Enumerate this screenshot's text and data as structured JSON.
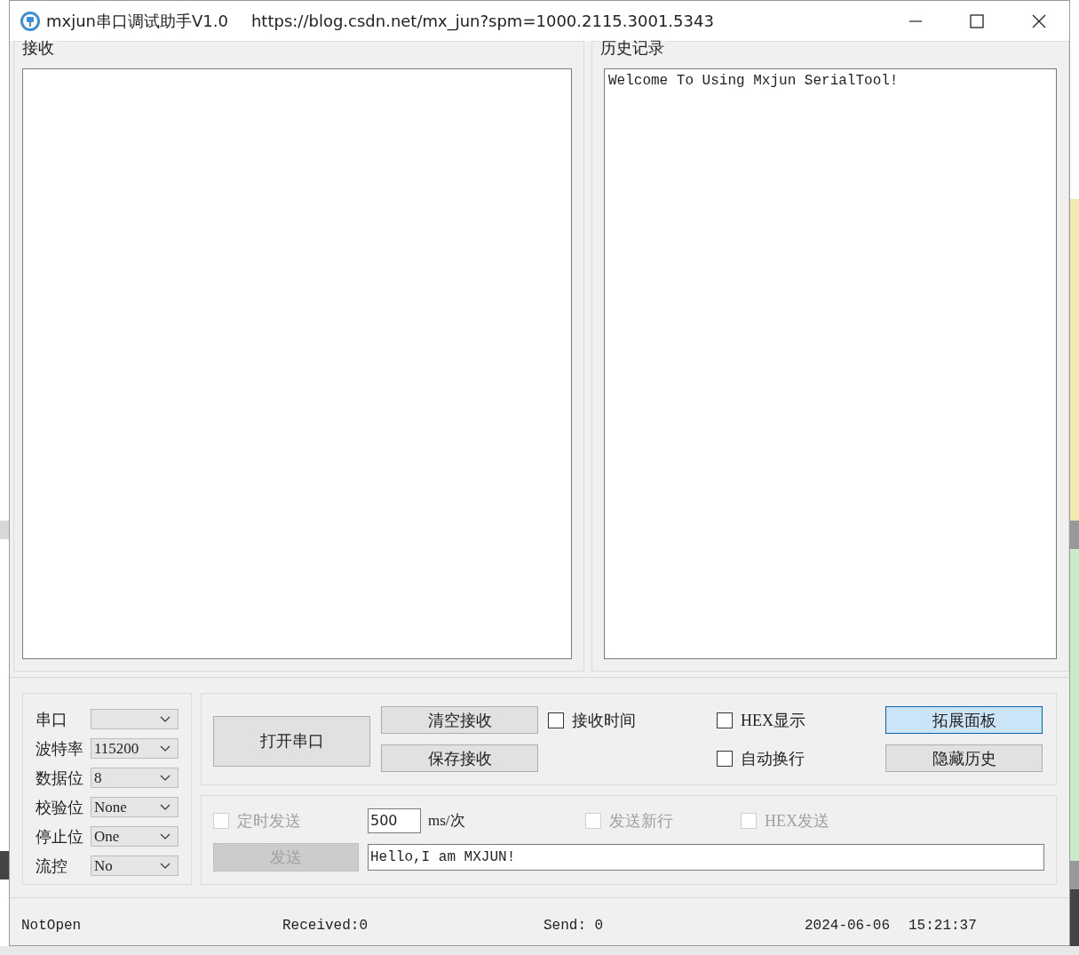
{
  "window": {
    "title": "mxjun串口调试助手V1.0",
    "url": "https://blog.csdn.net/mx_jun?spm=1000.2115.3001.5343"
  },
  "receive_panel": {
    "title": "接收"
  },
  "history_panel": {
    "title": "历史记录",
    "text": "Welcome To Using Mxjun SerialTool!"
  },
  "port_settings": [
    {
      "label": "串口"
    },
    {
      "label": "波特率",
      "value": "115200"
    },
    {
      "label": "数据位",
      "value": "8"
    },
    {
      "label": "校验位",
      "value": "None"
    },
    {
      "label": "停止位",
      "value": "One"
    },
    {
      "label": "流控",
      "value": "No"
    }
  ],
  "open_button": "打开串口",
  "receive_buttons": [
    {
      "label": "清空接收"
    },
    {
      "label": "保存接收"
    }
  ],
  "options": [
    {
      "label": "接收时间",
      "checked": false
    },
    {
      "label": "HEX显示",
      "checked": false
    },
    {
      "label": "自动换行",
      "checked": false
    }
  ],
  "panel_buttons": [
    {
      "label": "拓展面板",
      "selected": true
    },
    {
      "label": "隐藏历史",
      "selected": false
    }
  ],
  "send": {
    "timed": {
      "label": "定时发送",
      "checked": false,
      "disabled": true
    },
    "interval": "500",
    "unit": "ms/次",
    "options": [
      {
        "label": "发送新行",
        "checked": false,
        "disabled": true
      },
      {
        "label": "HEX发送",
        "checked": false,
        "disabled": true
      }
    ],
    "send_button": {
      "label": "发送",
      "disabled": true
    },
    "message": "Hello,I am MXJUN!"
  },
  "status_bar": [
    "NotOpen",
    "Received:0",
    "Send: 0",
    "2024-06-06",
    "15:21:37"
  ]
}
